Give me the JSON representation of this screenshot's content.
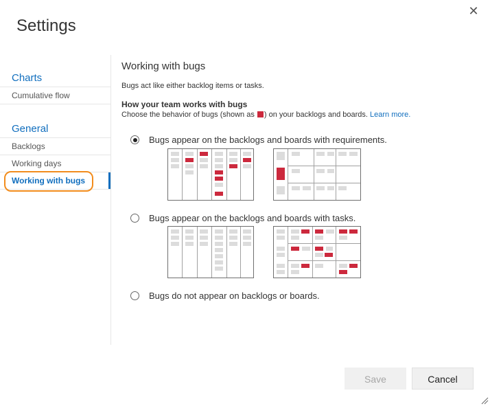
{
  "dialog": {
    "title": "Settings",
    "close_label": "✕"
  },
  "sidebar": {
    "groups": [
      {
        "title": "Charts",
        "items": [
          {
            "label": "Cumulative flow"
          }
        ]
      },
      {
        "title": "General",
        "items": [
          {
            "label": "Backlogs"
          },
          {
            "label": "Working days"
          },
          {
            "label": "Working with bugs",
            "selected": true
          }
        ]
      }
    ]
  },
  "main": {
    "title": "Working with bugs",
    "description": "Bugs act like either backlog items or tasks.",
    "subheading": "How your team works with bugs",
    "subdesc_before": "Choose the behavior of bugs (shown as",
    "subdesc_after": ") on your backlogs and boards.",
    "learn_more": "Learn more.",
    "options": [
      {
        "label": "Bugs appear on the backlogs and boards with requirements.",
        "checked": true
      },
      {
        "label": "Bugs appear on the backlogs and boards with tasks.",
        "checked": false
      },
      {
        "label": "Bugs do not appear on backlogs or boards.",
        "checked": false
      }
    ]
  },
  "footer": {
    "save_label": "Save",
    "cancel_label": "Cancel"
  },
  "colors": {
    "accent": "#106ebe",
    "bug": "#cc293d",
    "highlight": "#f28c1c",
    "card": "#dcdcdc"
  }
}
